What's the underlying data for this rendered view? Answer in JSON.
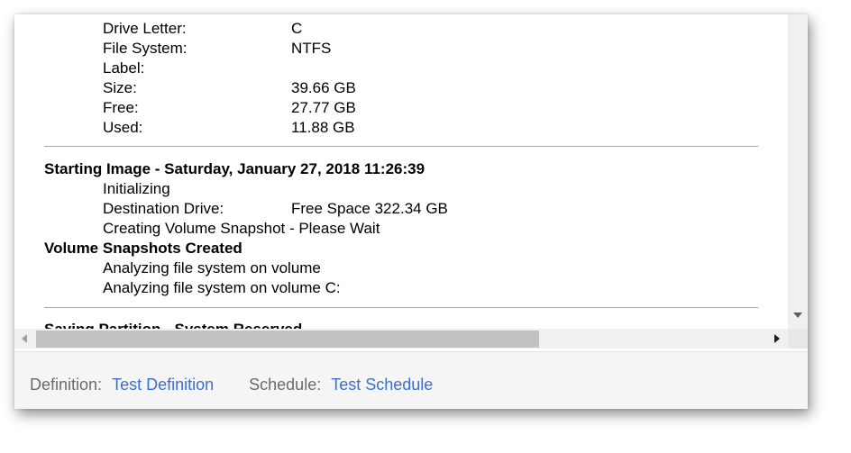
{
  "details": {
    "drive_letter_label": "Drive Letter:",
    "drive_letter_value": "C",
    "file_system_label": "File System:",
    "file_system_value": "NTFS",
    "label_label": "Label:",
    "label_value": "",
    "size_label": "Size:",
    "size_value": "39.66 GB",
    "free_label": "Free:",
    "free_value": "27.77 GB",
    "used_label": "Used:",
    "used_value": "11.88 GB"
  },
  "log": {
    "starting_heading": "Starting Image - Saturday, January 27, 2018 11:26:39",
    "initializing": "Initializing",
    "destination_label": "Destination Drive:",
    "destination_value": "Free Space 322.34 GB",
    "creating_snapshot": "Creating Volume Snapshot - Please Wait",
    "snapshots_heading": "Volume Snapshots Created",
    "analyzing_1": "Analyzing file system on volume",
    "analyzing_2": "Analyzing file system on volume C:",
    "saving_partition_heading": "Saving Partition - System Reserved"
  },
  "footer": {
    "definition_label": "Definition:",
    "definition_link": "Test Definition",
    "schedule_label": "Schedule:",
    "schedule_link": "Test Schedule"
  }
}
